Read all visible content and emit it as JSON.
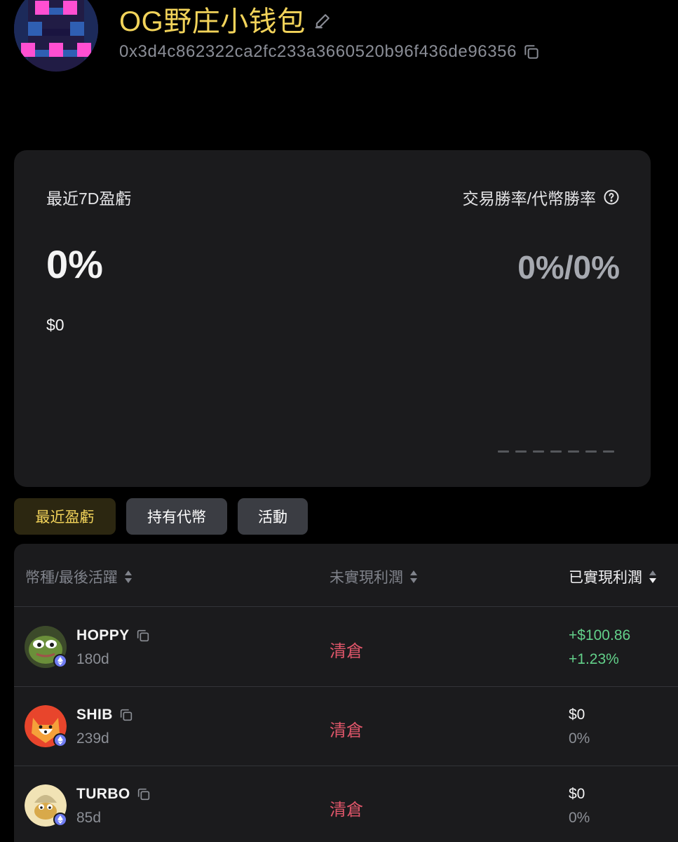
{
  "header": {
    "wallet_name": "OG野庄小钱包",
    "wallet_address": "0x3d4c862322ca2fc233a3660520b96f436de96356"
  },
  "stats": {
    "pnl_label": "最近7D盈虧",
    "pnl_percent": "0%",
    "pnl_usd": "$0",
    "winrate_label": "交易勝率/代幣勝率",
    "winrate_value": "0%/0%"
  },
  "tabs": [
    {
      "label": "最近盈虧",
      "active": true
    },
    {
      "label": "持有代幣",
      "active": false
    },
    {
      "label": "活動",
      "active": false
    }
  ],
  "table": {
    "columns": [
      "幣種/最後活躍",
      "未實現利潤",
      "已實現利潤"
    ],
    "rows": [
      {
        "token": "HOPPY",
        "age": "180d",
        "unrealized": "清倉",
        "realized_value": "+$100.86",
        "realized_percent": "+1.23%"
      },
      {
        "token": "SHIB",
        "age": "239d",
        "unrealized": "清倉",
        "realized_value": "$0",
        "realized_percent": "0%"
      },
      {
        "token": "TURBO",
        "age": "85d",
        "unrealized": "清倉",
        "realized_value": "$0",
        "realized_percent": "0%"
      }
    ]
  },
  "colors": {
    "accent_yellow": "#f2d35a",
    "positive_green": "#63d18a",
    "liquidated_red": "#e0566a",
    "card_bg": "#1b1b1d"
  }
}
